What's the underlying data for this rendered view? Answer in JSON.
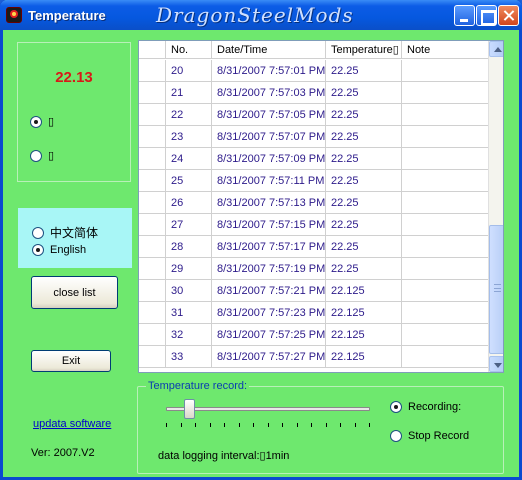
{
  "window": {
    "title": "Temperature",
    "brand": "DragonSteelMods"
  },
  "left": {
    "temperature": "22.13",
    "unit_c_label": "▯",
    "unit_f_label": "▯"
  },
  "language": {
    "chinese": "中文简体",
    "english": "English"
  },
  "buttons": {
    "close_list": "close list",
    "exit": "Exit"
  },
  "links": {
    "update": "updata software"
  },
  "version": "Ver: 2007.V2",
  "table": {
    "columns": [
      "",
      "No.",
      "Date/Time",
      "Temperature▯",
      "Note"
    ],
    "rows": [
      {
        "no": "20",
        "time": "8/31/2007 7:57:01 PM",
        "temp": "22.25",
        "note": ""
      },
      {
        "no": "21",
        "time": "8/31/2007 7:57:03 PM",
        "temp": "22.25",
        "note": ""
      },
      {
        "no": "22",
        "time": "8/31/2007 7:57:05 PM",
        "temp": "22.25",
        "note": ""
      },
      {
        "no": "23",
        "time": "8/31/2007 7:57:07 PM",
        "temp": "22.25",
        "note": ""
      },
      {
        "no": "24",
        "time": "8/31/2007 7:57:09 PM",
        "temp": "22.25",
        "note": ""
      },
      {
        "no": "25",
        "time": "8/31/2007 7:57:11 PM",
        "temp": "22.25",
        "note": ""
      },
      {
        "no": "26",
        "time": "8/31/2007 7:57:13 PM",
        "temp": "22.25",
        "note": ""
      },
      {
        "no": "27",
        "time": "8/31/2007 7:57:15 PM",
        "temp": "22.25",
        "note": ""
      },
      {
        "no": "28",
        "time": "8/31/2007 7:57:17 PM",
        "temp": "22.25",
        "note": ""
      },
      {
        "no": "29",
        "time": "8/31/2007 7:57:19 PM",
        "temp": "22.25",
        "note": ""
      },
      {
        "no": "30",
        "time": "8/31/2007 7:57:21 PM",
        "temp": "22.125",
        "note": ""
      },
      {
        "no": "31",
        "time": "8/31/2007 7:57:23 PM",
        "temp": "22.125",
        "note": ""
      },
      {
        "no": "32",
        "time": "8/31/2007 7:57:25 PM",
        "temp": "22.125",
        "note": ""
      },
      {
        "no": "33",
        "time": "8/31/2007 7:57:27 PM",
        "temp": "22.125",
        "note": ""
      }
    ]
  },
  "record": {
    "legend": "Temperature record:",
    "recording_label": "Recording:",
    "stop_label": "Stop Record",
    "interval_text": "data logging interval:▯1min",
    "slider_position": 0.12,
    "tick_count": 15
  },
  "icons": [
    "app-icon",
    "minimize-icon",
    "maximize-icon",
    "close-icon"
  ]
}
